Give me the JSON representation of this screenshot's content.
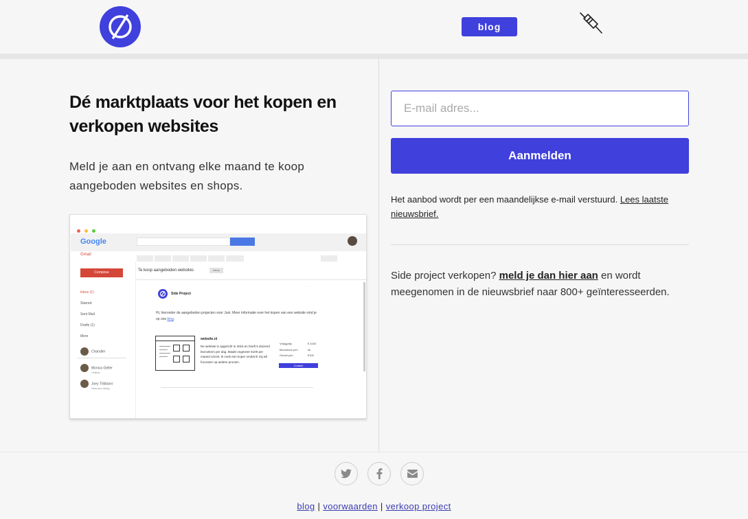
{
  "header": {
    "blog_label": "blog"
  },
  "hero": {
    "headline": "Dé marktplaats voor het kopen en verkopen websites",
    "subtext": "Meld je aan en ontvang elke maand te koop aangeboden websites en shops."
  },
  "mock": {
    "google_label": "Google",
    "gmail_label": "Gmail",
    "compose_label": "Compose",
    "sidebar": [
      "Inbox (1)",
      "Starred",
      "Sent Mail",
      "Drafts (1)",
      "More"
    ],
    "contacts": [
      {
        "name": "Chandler",
        "status": ""
      },
      {
        "name": "Monica Geller",
        "status": "I follow"
      },
      {
        "name": "Joey Tribbiani",
        "status": "How you doing"
      }
    ],
    "mail_subject": "Te koop aangeboden websites",
    "mail_tag": "Inbox",
    "brand": "Side Project",
    "intro_text": "Hi, hieronder de aangeboden projecten voor Juni. Meer informatie over het kopen van een website vind je op ons ",
    "intro_link": "blog",
    "site_name": "website.nl",
    "site_desc": "De website is opgericht in 2015 en heeft 5 duizend bezoekers per dag. Maakt ongeveer €100 per maand omzet. Ik zoek een koper omdat ik mij wil focussen op andere procten.",
    "stats_labels": [
      "Vraagprijs",
      "Bezoekers p/m",
      "Omzet p/m"
    ],
    "stats_values": [
      "€ 1000",
      "4k",
      "€100"
    ],
    "contact_btn": "Contact"
  },
  "signup": {
    "email_placeholder": "E-mail adres...",
    "email_value": "",
    "submit_label": "Aanmelden",
    "note_text": "Het aanbod wordt per een maandelijkse e-mail verstuurd. ",
    "note_link": "Lees laatste nieuwsbrief."
  },
  "sell": {
    "prefix": "Side project verkopen? ",
    "link": "meld je dan hier aan",
    "suffix": " en wordt meegenomen in de nieuwsbrief naar 800+ geïnteresseerden."
  },
  "footer": {
    "links": [
      "blog",
      "voorwaarden",
      "verkoop project"
    ],
    "separator": " | ",
    "social_icons": [
      "twitter-icon",
      "facebook-icon",
      "mail-icon"
    ]
  },
  "colors": {
    "brand": "#4040dd",
    "background": "#f6f6f6",
    "gmail_red": "#d44638"
  }
}
